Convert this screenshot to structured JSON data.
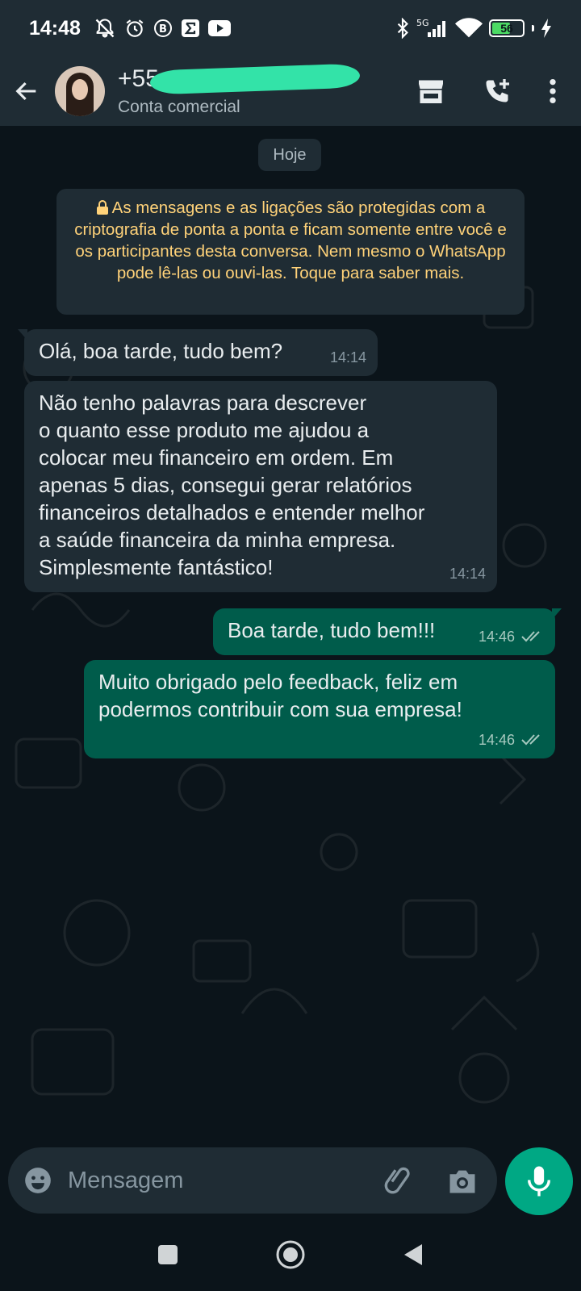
{
  "status_bar": {
    "time": "14:48",
    "network": "5G",
    "battery": "56",
    "icons": [
      "mute-icon",
      "alarm-icon",
      "b-icon",
      "sigma-icon",
      "youtube-icon",
      "bluetooth-icon",
      "signal-icon",
      "wifi-icon",
      "battery-icon",
      "charging-icon"
    ]
  },
  "header": {
    "contact_name": "+55",
    "contact_subtitle": "Conta comercial",
    "icons": [
      "back-arrow-icon",
      "store-icon",
      "add-call-icon",
      "more-vert-icon"
    ]
  },
  "chat": {
    "date_chip": "Hoje",
    "encryption_notice": "As mensagens e as ligações são protegidas com a criptografia de ponta a ponta e ficam somente entre você e os participantes desta conversa. Nem mesmo o WhatsApp pode lê-las ou ouvi-las. Toque para saber mais.",
    "messages": [
      {
        "direction": "incoming",
        "lines": [
          "Olá, boa tarde, tudo bem?"
        ],
        "time": "14:14"
      },
      {
        "direction": "incoming",
        "lines": [
          "Não tenho palavras para descrever",
          "o quanto esse produto me ajudou a",
          "colocar meu financeiro em ordem. Em",
          "apenas 5 dias, consegui gerar relatórios",
          "financeiros detalhados e entender melhor",
          "a saúde financeira da minha empresa.",
          "Simplesmente fantástico!"
        ],
        "time": "14:14"
      },
      {
        "direction": "outgoing",
        "lines": [
          "Boa tarde, tudo bem!!!"
        ],
        "time": "14:46",
        "status": "read"
      },
      {
        "direction": "outgoing",
        "lines": [
          "Muito obrigado pelo feedback, feliz em",
          "podermos contribuir com sua empresa!"
        ],
        "time": "14:46",
        "status": "read"
      }
    ]
  },
  "composer": {
    "placeholder": "Mensagem",
    "icons": [
      "emoji-icon",
      "attach-icon",
      "camera-icon",
      "mic-icon"
    ]
  },
  "colors": {
    "background": "#0b141a",
    "bar": "#1f2c34",
    "incoming_bubble": "#1f2c34",
    "outgoing_bubble": "#005c4b",
    "accent": "#00a884",
    "notice_text": "#ffd279"
  }
}
